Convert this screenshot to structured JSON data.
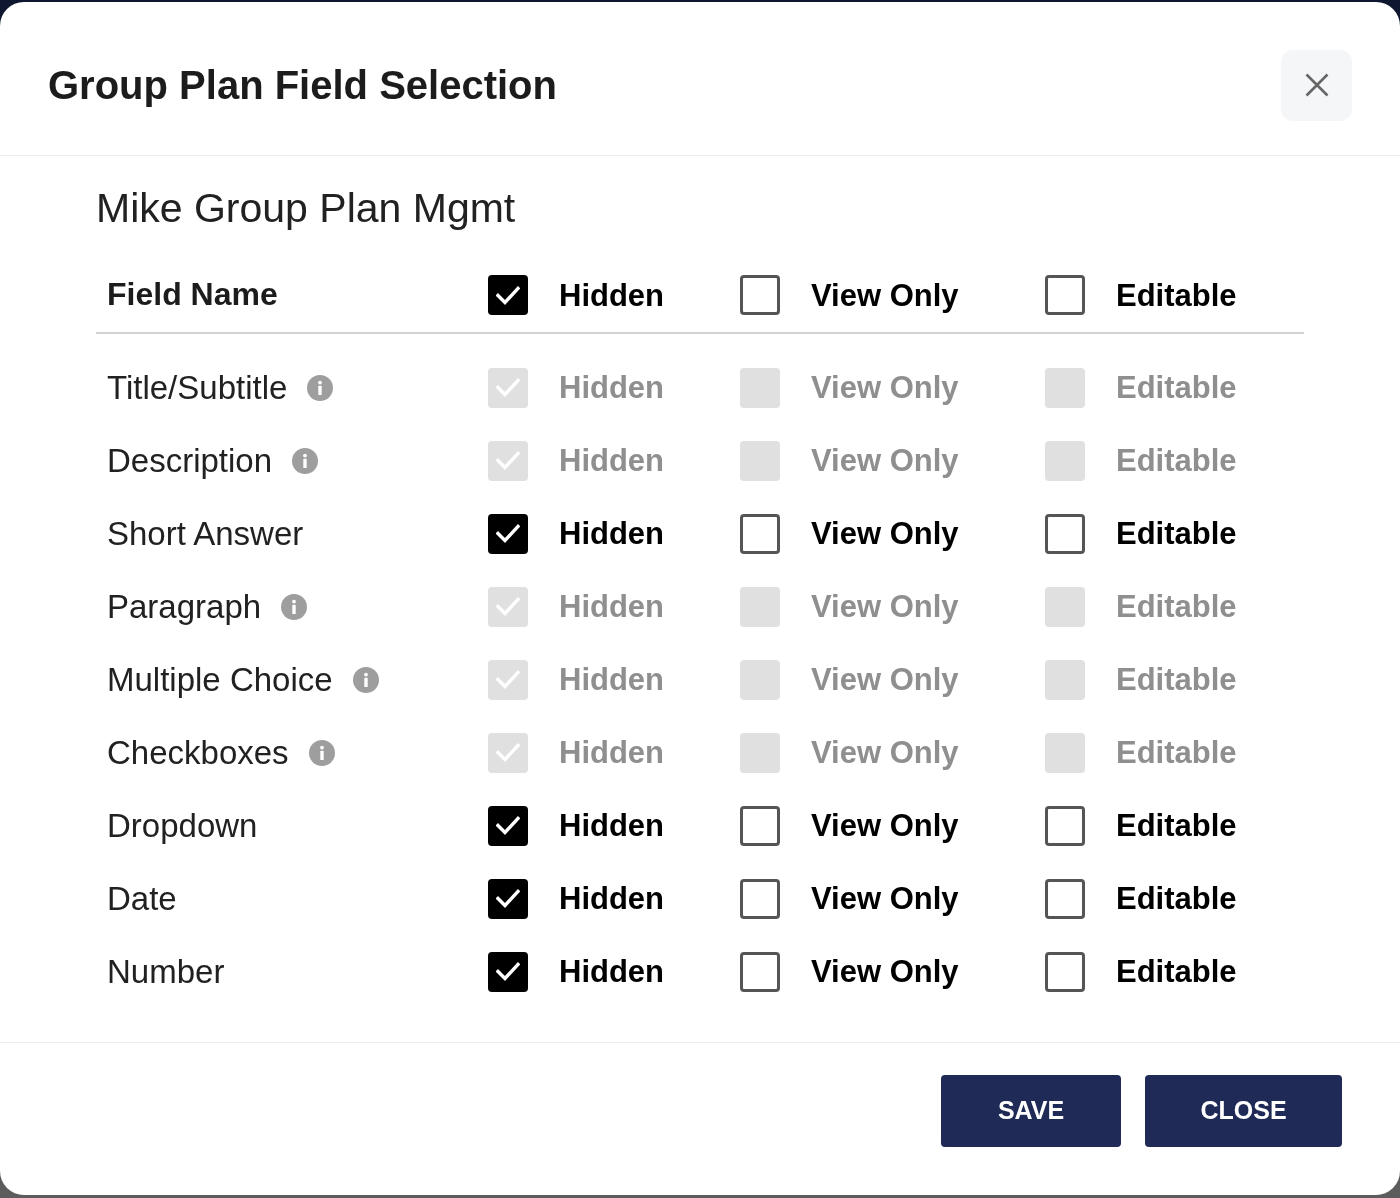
{
  "dialog": {
    "title": "Group Plan Field Selection"
  },
  "section_title": "Mike Group Plan Mgmt",
  "table": {
    "header": {
      "field_label": "Field Name",
      "options": [
        {
          "label": "Hidden",
          "checked": true
        },
        {
          "label": "View Only",
          "checked": false
        },
        {
          "label": "Editable",
          "checked": false
        }
      ]
    },
    "rows": [
      {
        "name": "Title/Subtitle",
        "info": true,
        "options": [
          {
            "label": "Hidden",
            "checked": true,
            "disabled": true
          },
          {
            "label": "View Only",
            "checked": false,
            "disabled": true
          },
          {
            "label": "Editable",
            "checked": false,
            "disabled": true
          }
        ]
      },
      {
        "name": "Description",
        "info": true,
        "options": [
          {
            "label": "Hidden",
            "checked": true,
            "disabled": true
          },
          {
            "label": "View Only",
            "checked": false,
            "disabled": true
          },
          {
            "label": "Editable",
            "checked": false,
            "disabled": true
          }
        ]
      },
      {
        "name": "Short Answer",
        "info": false,
        "options": [
          {
            "label": "Hidden",
            "checked": true,
            "disabled": false
          },
          {
            "label": "View Only",
            "checked": false,
            "disabled": false
          },
          {
            "label": "Editable",
            "checked": false,
            "disabled": false
          }
        ]
      },
      {
        "name": "Paragraph",
        "info": true,
        "options": [
          {
            "label": "Hidden",
            "checked": true,
            "disabled": true
          },
          {
            "label": "View Only",
            "checked": false,
            "disabled": true
          },
          {
            "label": "Editable",
            "checked": false,
            "disabled": true
          }
        ]
      },
      {
        "name": "Multiple Choice",
        "info": true,
        "options": [
          {
            "label": "Hidden",
            "checked": true,
            "disabled": true
          },
          {
            "label": "View Only",
            "checked": false,
            "disabled": true
          },
          {
            "label": "Editable",
            "checked": false,
            "disabled": true
          }
        ]
      },
      {
        "name": "Checkboxes",
        "info": true,
        "options": [
          {
            "label": "Hidden",
            "checked": true,
            "disabled": true
          },
          {
            "label": "View Only",
            "checked": false,
            "disabled": true
          },
          {
            "label": "Editable",
            "checked": false,
            "disabled": true
          }
        ]
      },
      {
        "name": "Dropdown",
        "info": false,
        "options": [
          {
            "label": "Hidden",
            "checked": true,
            "disabled": false
          },
          {
            "label": "View Only",
            "checked": false,
            "disabled": false
          },
          {
            "label": "Editable",
            "checked": false,
            "disabled": false
          }
        ]
      },
      {
        "name": "Date",
        "info": false,
        "options": [
          {
            "label": "Hidden",
            "checked": true,
            "disabled": false
          },
          {
            "label": "View Only",
            "checked": false,
            "disabled": false
          },
          {
            "label": "Editable",
            "checked": false,
            "disabled": false
          }
        ]
      },
      {
        "name": "Number",
        "info": false,
        "options": [
          {
            "label": "Hidden",
            "checked": true,
            "disabled": false
          },
          {
            "label": "View Only",
            "checked": false,
            "disabled": false
          },
          {
            "label": "Editable",
            "checked": false,
            "disabled": false
          }
        ]
      }
    ]
  },
  "buttons": [
    {
      "label": "SAVE"
    },
    {
      "label": "CLOSE"
    }
  ]
}
